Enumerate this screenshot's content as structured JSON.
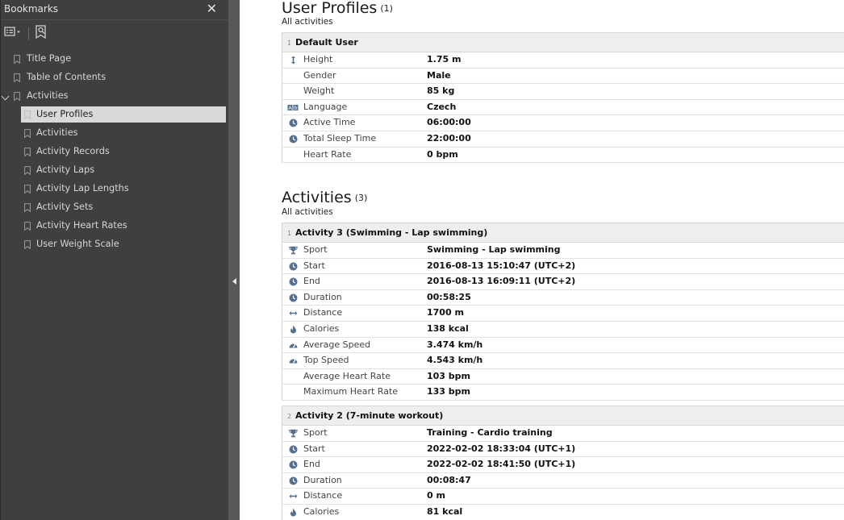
{
  "sidebar": {
    "title": "Bookmarks",
    "items": [
      {
        "label": "Title Page"
      },
      {
        "label": "Table of Contents"
      },
      {
        "label": "Activities"
      },
      {
        "label": "User Profiles"
      },
      {
        "label": "Activities"
      },
      {
        "label": "Activity Records"
      },
      {
        "label": "Activity Laps"
      },
      {
        "label": "Activity Lap Lengths"
      },
      {
        "label": "Activity Sets"
      },
      {
        "label": "Activity Heart Rates"
      },
      {
        "label": "User Weight Scale"
      }
    ]
  },
  "user_profiles": {
    "title": "User Profiles",
    "count": "(1)",
    "subtitle": "All activities",
    "table": {
      "index": "1",
      "title": "Default User",
      "rows": [
        {
          "icon": "height-icon",
          "key": "Height",
          "value": "1.75 m"
        },
        {
          "icon": "",
          "key": "Gender",
          "value": "Male"
        },
        {
          "icon": "",
          "key": "Weight",
          "value": "85 kg"
        },
        {
          "icon": "language-icon",
          "key": "Language",
          "value": "Czech"
        },
        {
          "icon": "clock-icon",
          "key": "Active Time",
          "value": "06:00:00"
        },
        {
          "icon": "clock-icon",
          "key": "Total Sleep Time",
          "value": "22:00:00"
        },
        {
          "icon": "",
          "key": "Heart Rate",
          "value": "0 bpm"
        }
      ]
    }
  },
  "activities": {
    "title": "Activities",
    "count": "(3)",
    "subtitle": "All activities",
    "tables": [
      {
        "index": "1",
        "title": "Activity 3 (Swimming - Lap swimming)",
        "rows": [
          {
            "icon": "trophy-icon",
            "key": "Sport",
            "value": "Swimming - Lap swimming"
          },
          {
            "icon": "clock-icon",
            "key": "Start",
            "value": "2016-08-13 15:10:47 (UTC+2)"
          },
          {
            "icon": "clock-icon",
            "key": "End",
            "value": "2016-08-13 16:09:11 (UTC+2)"
          },
          {
            "icon": "clock-icon",
            "key": "Duration",
            "value": "00:58:25"
          },
          {
            "icon": "distance-icon",
            "key": "Distance",
            "value": "1700 m"
          },
          {
            "icon": "flame-icon",
            "key": "Calories",
            "value": "138 kcal"
          },
          {
            "icon": "speedometer-icon",
            "key": "Average Speed",
            "value": "3.474 km/h"
          },
          {
            "icon": "speedometer-icon",
            "key": "Top Speed",
            "value": "4.543 km/h"
          },
          {
            "icon": "",
            "key": "Average Heart Rate",
            "value": "103 bpm"
          },
          {
            "icon": "",
            "key": "Maximum Heart Rate",
            "value": "133 bpm"
          }
        ]
      },
      {
        "index": "2",
        "title": "Activity 2 (7-minute workout)",
        "rows": [
          {
            "icon": "trophy-icon",
            "key": "Sport",
            "value": "Training - Cardio training"
          },
          {
            "icon": "clock-icon",
            "key": "Start",
            "value": "2022-02-02 18:33:04 (UTC+1)"
          },
          {
            "icon": "clock-icon",
            "key": "End",
            "value": "2022-02-02 18:41:50 (UTC+1)"
          },
          {
            "icon": "clock-icon",
            "key": "Duration",
            "value": "00:08:47"
          },
          {
            "icon": "distance-icon",
            "key": "Distance",
            "value": "0 m"
          },
          {
            "icon": "flame-icon",
            "key": "Calories",
            "value": "81 kcal"
          }
        ]
      }
    ]
  }
}
